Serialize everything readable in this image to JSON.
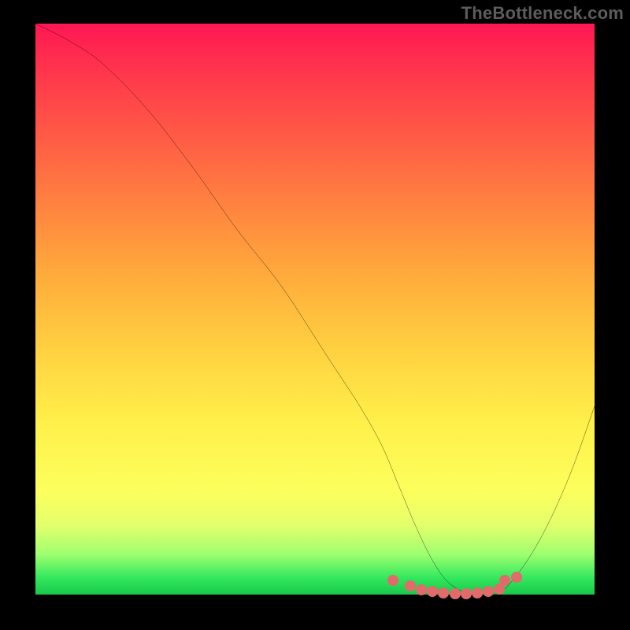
{
  "watermark": "TheBottleneck.com",
  "chart_data": {
    "type": "line",
    "title": "",
    "xlabel": "",
    "ylabel": "",
    "xlim": [
      0,
      100
    ],
    "ylim": [
      0,
      100
    ],
    "x": [
      0,
      6,
      12,
      20,
      28,
      36,
      44,
      52,
      58,
      62,
      65,
      68,
      71,
      74,
      78,
      82,
      84,
      88,
      92,
      96,
      100
    ],
    "values": [
      100,
      97,
      93,
      85,
      75,
      64,
      54,
      42,
      33,
      26,
      19,
      12,
      6,
      2,
      0,
      0,
      1,
      6,
      13,
      22,
      33
    ],
    "series": [
      {
        "name": "markers",
        "x": [
          64,
          67,
          69,
          71,
          73,
          75,
          77,
          79,
          81,
          83,
          84,
          86
        ],
        "values": [
          2.5,
          1.5,
          0.8,
          0.5,
          0.3,
          0.2,
          0.2,
          0.3,
          0.5,
          1.0,
          2.5,
          3.0
        ]
      }
    ],
    "annotations": []
  },
  "colors": {
    "curve": "#000000",
    "marker": "#e26a6a",
    "background_frame": "#000000"
  }
}
